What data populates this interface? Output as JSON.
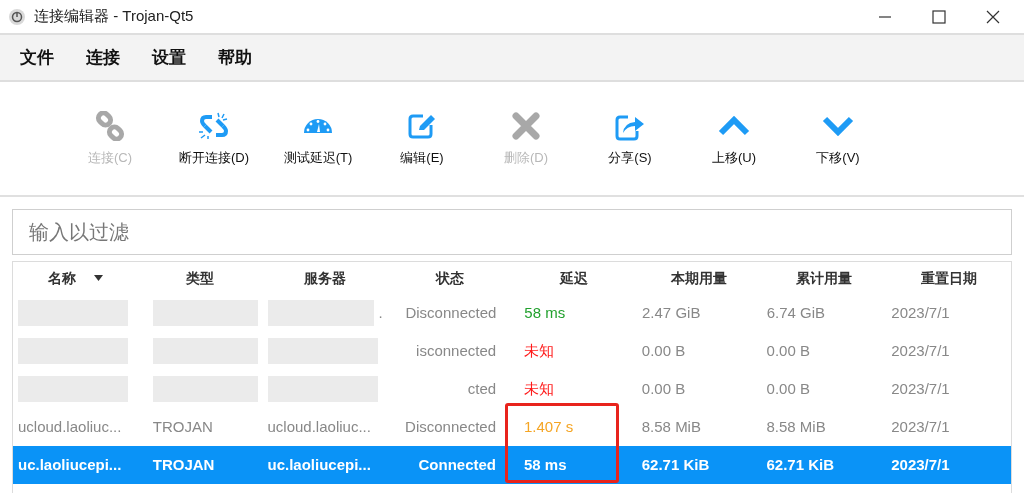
{
  "window": {
    "title": "连接编辑器 - Trojan-Qt5"
  },
  "menu": [
    "文件",
    "连接",
    "设置",
    "帮助"
  ],
  "toolbar": [
    {
      "kind": "link",
      "label": "连接(C)",
      "disabled": true
    },
    {
      "kind": "unlink",
      "label": "断开连接(D)",
      "disabled": false
    },
    {
      "kind": "gauge",
      "label": "测试延迟(T)",
      "disabled": false
    },
    {
      "kind": "edit",
      "label": "编辑(E)",
      "disabled": false
    },
    {
      "kind": "delete",
      "label": "删除(D)",
      "disabled": true
    },
    {
      "kind": "share",
      "label": "分享(S)",
      "disabled": false
    },
    {
      "kind": "up",
      "label": "上移(U)",
      "disabled": false
    },
    {
      "kind": "down",
      "label": "下移(V)",
      "disabled": false
    }
  ],
  "filter": {
    "placeholder": "输入以过滤"
  },
  "table": {
    "columns": [
      {
        "label": "名称",
        "sorted": true
      },
      {
        "label": "类型",
        "sorted": false
      },
      {
        "label": "服务器",
        "sorted": false
      },
      {
        "label": "状态",
        "sorted": false
      },
      {
        "label": "延迟",
        "sorted": false
      },
      {
        "label": "本期用量",
        "sorted": false
      },
      {
        "label": "累计用量",
        "sorted": false
      },
      {
        "label": "重置日期",
        "sorted": false
      }
    ],
    "rows": [
      {
        "selected": false,
        "name": null,
        "type": null,
        "server": ".",
        "status": "Disconnected",
        "latency": "58 ms",
        "color": "#22a12e",
        "period": "2.47  GiB",
        "total": "6.74  GiB",
        "reset": "2023/7/1"
      },
      {
        "selected": false,
        "name": null,
        "type": null,
        "server": null,
        "status": "isconnected",
        "latency": "未知",
        "color": "#ff1a1a",
        "period": "0.00  B",
        "total": "0.00  B",
        "reset": "2023/7/1"
      },
      {
        "selected": false,
        "name": null,
        "type": null,
        "server": null,
        "status": "cted",
        "latency": "未知",
        "color": "#ff1a1a",
        "period": "0.00  B",
        "total": "0.00  B",
        "reset": "2023/7/1"
      },
      {
        "selected": false,
        "name": "ucloud.laoliuc...",
        "type": "TROJAN",
        "server": "ucloud.laoliuc...",
        "status": "Disconnected",
        "latency": "1.407 s",
        "color": "#f5a524",
        "period": "8.58  MiB",
        "total": "8.58  MiB",
        "reset": "2023/7/1"
      },
      {
        "selected": true,
        "name": "uc.laoliucepi...",
        "type": "TROJAN",
        "server": "uc.laoliucepi...",
        "status": "Connected",
        "latency": "58 ms",
        "color": "#ffffff",
        "period": "62.71  KiB",
        "total": "62.71  KiB",
        "reset": "2023/7/1"
      }
    ]
  }
}
